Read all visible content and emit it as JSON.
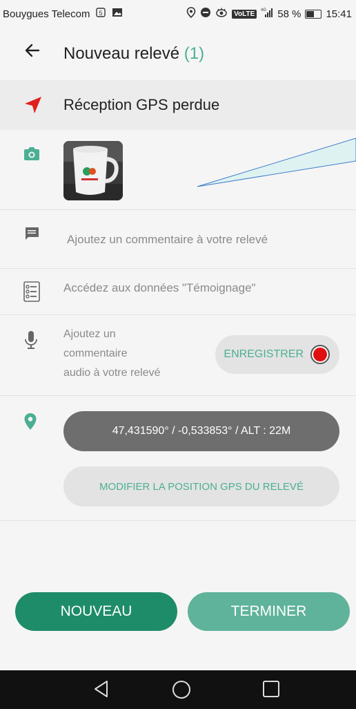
{
  "statusbar": {
    "carrier": "Bouygues Telecom",
    "network_badge": "VoLTE",
    "network_type": "4G",
    "battery_text": "58 %",
    "battery_level": 0.58,
    "time": "15:41"
  },
  "header": {
    "title": "Nouveau relevé",
    "count": "(1)"
  },
  "gps_status": {
    "label": "Réception GPS perdue",
    "icon": "navigation-arrow-icon",
    "icon_color": "#e02020"
  },
  "photo": {
    "icon": "camera-icon"
  },
  "comment": {
    "icon": "message-icon",
    "placeholder": "Ajoutez un commentaire à votre relevé"
  },
  "testimony": {
    "icon": "list-icon",
    "label": "Accédez aux données \"Témoignage\""
  },
  "audio": {
    "icon": "microphone-icon",
    "text_line1": "Ajoutez un",
    "text_line2": "commentaire",
    "text_line3": "audio à votre relevé",
    "record_label": "ENREGISTRER"
  },
  "location": {
    "icon": "map-pin-icon",
    "coordinates": "47,431590° / -0,533853° / ALT : 22M",
    "modify_label": "MODIFIER LA POSITION GPS DU RELEVÉ"
  },
  "actions": {
    "new_label": "NOUVEAU",
    "finish_label": "TERMINER"
  },
  "colors": {
    "accent": "#4caf93",
    "primary_button": "#1e8c68",
    "secondary_button": "#5fb39a",
    "record_red": "#e01010"
  }
}
